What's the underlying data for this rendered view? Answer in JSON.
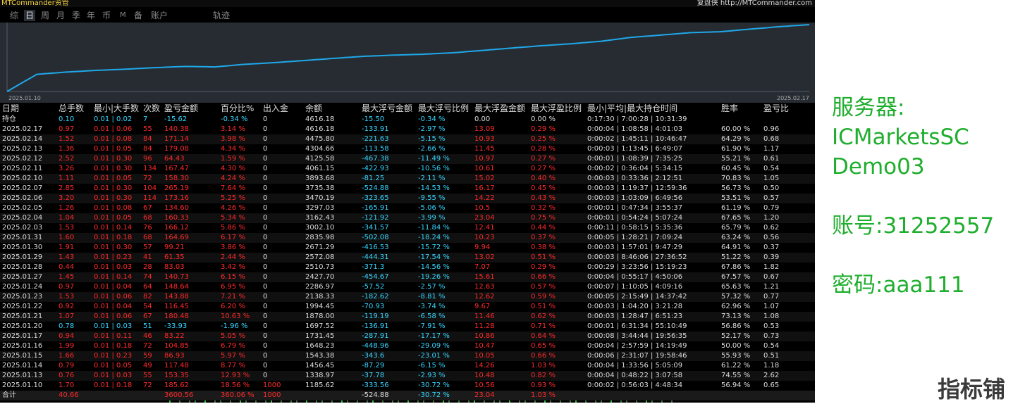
{
  "app": {
    "title": "MTCommander资管",
    "replay_label": "复盘侠 http://MTCommander.com"
  },
  "tabs": [
    "综",
    "日",
    "周",
    "月",
    "季",
    "年",
    "币",
    "M",
    "备",
    "账户",
    "轨迹"
  ],
  "active_tab": "日",
  "chart": {
    "start_date": "2025.01.10",
    "end_date": "2025.02.17",
    "line_color": "#1fa8e8",
    "background": "#272c33"
  },
  "table": {
    "columns": [
      "日期",
      "总手数",
      "最小|大手数",
      "次数",
      "盈亏金额",
      "百分比%",
      "出入金",
      "余额",
      "最大浮亏金额",
      "最大浮亏比例",
      "最大浮盈金额",
      "最大浮盈比例",
      "最小|平均|最大持仓时间",
      "胜率",
      "盈亏比"
    ],
    "holding": {
      "label": "持仓",
      "values": [
        "0.10",
        "0.01 | 0.02",
        "7",
        "-15.62",
        "-0.34 %",
        "0",
        "4616.18",
        "-15.50",
        "-0.34 %",
        "0.00",
        "0.00 %",
        "0:17:30 | 7:00:28 | 10:31:39",
        "",
        ""
      ],
      "colors": [
        "c",
        "c",
        "c",
        "c",
        "c",
        "w",
        "w",
        "c",
        "c",
        "w",
        "w",
        "w",
        "w",
        "w"
      ]
    },
    "rows": [
      [
        "2025.02.17",
        "0.97",
        "0.01 | 0.06",
        "55",
        "140.38",
        "3.14 %",
        "0",
        "4616.18",
        "-133.91",
        "-2.97 %",
        "13.09",
        "0.29 %",
        "0:00:04 | 1:08:58 | 4:01:03",
        "60.00 %",
        "0.96"
      ],
      [
        "2025.02.14",
        "1.52",
        "0.01 | 0.08",
        "84",
        "171.14",
        "3.98 %",
        "0",
        "4475.80",
        "-221.63",
        "-5.15 %",
        "10.93",
        "0.25 %",
        "0:00:02 | 1:45:11 | 10:46:47",
        "64.29 %",
        "0.68"
      ],
      [
        "2025.02.13",
        "1.36",
        "0.01 | 0.05",
        "84",
        "179.08",
        "4.34 %",
        "0",
        "4304.66",
        "-113.58",
        "-2.66 %",
        "11.45",
        "0.28 %",
        "0:00:03 | 1:13:45 | 6:49:07",
        "61.90 %",
        "1.17"
      ],
      [
        "2025.02.12",
        "2.52",
        "0.01 | 0.30",
        "96",
        "64.43",
        "1.59 %",
        "0",
        "4125.58",
        "-467.38",
        "-11.49 %",
        "10.97",
        "0.27 %",
        "0:00:01 | 1:08:39 | 7:35:25",
        "55.21 %",
        "0.61"
      ],
      [
        "2025.02.11",
        "3.26",
        "0.01 | 0.30",
        "134",
        "167.47",
        "4.30 %",
        "0",
        "4061.15",
        "-422.93",
        "-10.56 %",
        "10.61",
        "0.27 %",
        "0:00:02 | 0:36:04 | 5:34:15",
        "60.45 %",
        "0.54"
      ],
      [
        "2025.02.10",
        "1.11",
        "0.01 | 0.05",
        "72",
        "158.30",
        "4.24 %",
        "0",
        "3893.68",
        "-81.25",
        "-2.11 %",
        "15.02",
        "0.40 %",
        "0:00:03 | 0:33:36 | 2:12:51",
        "70.83 %",
        "1.05"
      ],
      [
        "2025.02.07",
        "2.85",
        "0.01 | 0.30",
        "104",
        "265.19",
        "7.64 %",
        "0",
        "3735.38",
        "-524.88",
        "-14.53 %",
        "16.17",
        "0.45 %",
        "0:00:03 | 1:19:37 | 12:59:36",
        "56.73 %",
        "0.50"
      ],
      [
        "2025.02.06",
        "3.20",
        "0.01 | 0.30",
        "114",
        "173.16",
        "5.25 %",
        "0",
        "3470.19",
        "-323.65",
        "-9.55 %",
        "14.22",
        "0.43 %",
        "0:00:03 | 1:03:09 | 6:49:56",
        "53.51 %",
        "0.57"
      ],
      [
        "2025.02.05",
        "1.26",
        "0.01 | 0.08",
        "67",
        "134.60",
        "4.26 %",
        "0",
        "3297.03",
        "-165.91",
        "-5.06 %",
        "10.5",
        "0.32 %",
        "0:00:01 | 0:47:34 | 3:55:37",
        "61.19 %",
        "0.79"
      ],
      [
        "2025.02.04",
        "1.04",
        "0.01 | 0.05",
        "68",
        "160.33",
        "5.34 %",
        "0",
        "3162.43",
        "-121.92",
        "-3.99 %",
        "23.04",
        "0.75 %",
        "0:00:01 | 0:54:24 | 5:07:24",
        "67.65 %",
        "1.20"
      ],
      [
        "2025.02.03",
        "1.53",
        "0.01 | 0.14",
        "76",
        "166.12",
        "5.86 %",
        "0",
        "3002.10",
        "-341.57",
        "-11.84 %",
        "12.41",
        "0.44 %",
        "0:00:11 | 0:58:15 | 5:35:36",
        "65.79 %",
        "0.62"
      ],
      [
        "2025.01.31",
        "1.60",
        "0.01 | 0.18",
        "68",
        "164.69",
        "6.17 %",
        "0",
        "2835.98",
        "-502.08",
        "-18.24 %",
        "10.23",
        "0.37 %",
        "0:00:05 | 1:28:21 | 7:09:24",
        "63.24 %",
        "0.56"
      ],
      [
        "2025.01.30",
        "1.91",
        "0.01 | 0.30",
        "57",
        "99.21",
        "3.86 %",
        "0",
        "2671.29",
        "-416.53",
        "-15.72 %",
        "9.94",
        "0.38 %",
        "0:00:03 | 1:57:01 | 9:47:29",
        "64.91 %",
        "0.37"
      ],
      [
        "2025.01.29",
        "1.43",
        "0.01 | 0.23",
        "41",
        "61.35",
        "2.44 %",
        "0",
        "2572.08",
        "-444.31",
        "-17.54 %",
        "13.02",
        "0.51 %",
        "0:00:03 | 8:46:06 | 27:36:52",
        "51.22 %",
        "0.39"
      ],
      [
        "2025.01.28",
        "0.44",
        "0.01 | 0.03",
        "28",
        "83.03",
        "3.42 %",
        "0",
        "2510.73",
        "-371.3",
        "-14.56 %",
        "7.07",
        "0.29 %",
        "0:00:29 | 3:23:56 | 15:19:23",
        "67.86 %",
        "1.82"
      ],
      [
        "2025.01.27",
        "1.45",
        "0.01 | 0.14",
        "74",
        "140.73",
        "6.15 %",
        "0",
        "2427.70",
        "-454.67",
        "-19.26 %",
        "15.61",
        "0.66 %",
        "0:00:04 | 0:55:17 | 4:50:06",
        "67.57 %",
        "0.67"
      ],
      [
        "2025.01.24",
        "0.97",
        "0.01 | 0.04",
        "64",
        "148.64",
        "6.95 %",
        "0",
        "2286.97",
        "-57.52",
        "-2.57 %",
        "12.63",
        "0.57 %",
        "0:00:07 | 1:10:05 | 4:09:16",
        "65.63 %",
        "1.21"
      ],
      [
        "2025.01.23",
        "1.53",
        "0.01 | 0.06",
        "82",
        "143.88",
        "7.21 %",
        "0",
        "2138.33",
        "-182.62",
        "-8.81 %",
        "12.62",
        "0.59 %",
        "0:00:05 | 2:15:49 | 14:37:42",
        "57.32 %",
        "0.77"
      ],
      [
        "2025.01.22",
        "0.92",
        "0.01 | 0.04",
        "54",
        "116.45",
        "6.20 %",
        "0",
        "1994.45",
        "-70.93",
        "-3.74 %",
        "9.67",
        "0.51 %",
        "0:00:03 | 1:04:20 | 3:21:28",
        "62.96 %",
        "1.07"
      ],
      [
        "2025.01.21",
        "1.07",
        "0.01 | 0.06",
        "67",
        "180.48",
        "10.63 %",
        "0",
        "1878.00",
        "-119.19",
        "-6.58 %",
        "11.46",
        "0.62 %",
        "0:00:03 | 1:28:47 | 6:51:23",
        "73.13 %",
        "1.08"
      ],
      [
        "2025.01.20",
        "0.78",
        "0.01 | 0.03",
        "51",
        "-33.93",
        "-1.96 %",
        "0",
        "1697.52",
        "-136.91",
        "-7.91 %",
        "11.28",
        "0.71 %",
        "0:00:01 | 6:31:34 | 55:10:49",
        "56.86 %",
        "0.53"
      ],
      [
        "2025.01.17",
        "0.94",
        "0.01 | 0.11",
        "46",
        "83.22",
        "5.05 %",
        "0",
        "1731.45",
        "-287.91",
        "-17.17 %",
        "10.86",
        "0.64 %",
        "0:00:08 | 3:44:44 | 19:56:35",
        "52.17 %",
        "0.73"
      ],
      [
        "2025.01.16",
        "1.99",
        "0.01 | 0.18",
        "72",
        "104.85",
        "6.79 %",
        "0",
        "1648.23",
        "-448.96",
        "-29.09 %",
        "10.47",
        "0.65 %",
        "0:00:04 | 2:57:59 | 14:19:49",
        "50.00 %",
        "0.54"
      ],
      [
        "2025.01.15",
        "1.66",
        "0.01 | 0.23",
        "59",
        "86.93",
        "5.97 %",
        "0",
        "1543.38",
        "-343.6",
        "-23.01 %",
        "10.05",
        "0.66 %",
        "0:00:06 | 2:31:07 | 19:58:46",
        "55.93 %",
        "0.51"
      ],
      [
        "2025.01.14",
        "0.79",
        "0.01 | 0.05",
        "49",
        "117.48",
        "8.77 %",
        "0",
        "1456.45",
        "-87.29",
        "-6.15 %",
        "14.26",
        "1.03 %",
        "0:00:04 | 1:33:56 | 5:05:09",
        "61.22 %",
        "1.18"
      ],
      [
        "2025.01.13",
        "0.76",
        "0.01 | 0.03",
        "55",
        "153.35",
        "12.93 %",
        "0",
        "1338.97",
        "-37.78",
        "-2.93 %",
        "10.48",
        "0.82 %",
        "0:00:04 | 0:48:22 | 3:07:58",
        "74.55 %",
        "2.62"
      ],
      [
        "2025.01.10",
        "1.70",
        "0.01 | 0.18",
        "72",
        "185.62",
        "18.56 %",
        "1000",
        "1185.62",
        "-333.56",
        "-30.72 %",
        "10.56",
        "0.93 %",
        "0:00:02 | 0:56:03 | 4:48:34",
        "56.94 %",
        "0.65"
      ]
    ],
    "total": {
      "label": "合计",
      "values": [
        "40.66",
        "",
        "",
        "3600.56",
        "360.06 %",
        "1000",
        "",
        "-524.88",
        "-30.72 %",
        "23.04",
        "1.03 %",
        "",
        "",
        ""
      ]
    }
  },
  "info": {
    "server_label": "服务器:",
    "server_value_1": "ICMarketsSC",
    "server_value_2": "Demo03",
    "account_label": "账号:",
    "account_value": "31252557",
    "password_label": "密码:",
    "password_value": "aaa111",
    "color": "#1fae2e"
  },
  "watermark": "指标铺"
}
